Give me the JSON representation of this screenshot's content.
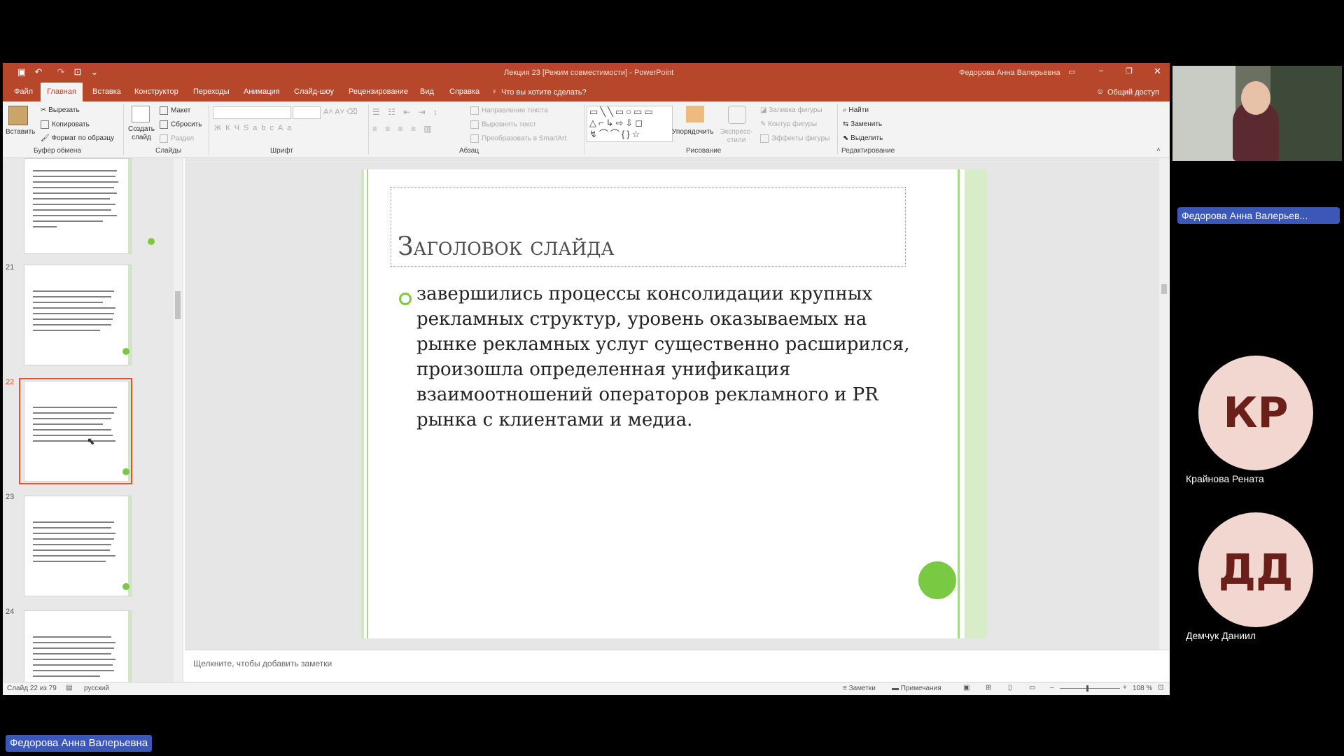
{
  "window": {
    "title": "Лекция 23 [Режим совместимости]  -  PowerPoint",
    "user": "Федорова Анна Валерьевна"
  },
  "tabs": [
    "Файл",
    "Главная",
    "Вставка",
    "Конструктор",
    "Переходы",
    "Анимация",
    "Слайд-шоу",
    "Рецензирование",
    "Вид",
    "Справка"
  ],
  "tell_me": "Что вы хотите сделать?",
  "share": "Общий доступ",
  "ribbon": {
    "clipboard": {
      "paste": "Вставить",
      "cut": "Вырезать",
      "copy": "Копировать",
      "format": "Формат по образцу",
      "label": "Буфер обмена"
    },
    "slides": {
      "new_slide": "Создать слайд",
      "layout": "Макет",
      "reset": "Сбросить",
      "section": "Раздел",
      "label": "Слайды"
    },
    "font": {
      "label": "Шрифт"
    },
    "paragraph": {
      "text_dir": "Направление текста",
      "align_text": "Выровнять текст",
      "smartart": "Преобразовать в SmartArt",
      "label": "Абзац"
    },
    "drawing": {
      "arrange": "Упорядочить",
      "quick_styles": "Экспресс-стили",
      "fill": "Заливка фигуры",
      "outline": "Контур фигуры",
      "effects": "Эффекты фигуры",
      "label": "Рисование"
    },
    "editing": {
      "find": "Найти",
      "replace": "Заменить",
      "select": "Выделить",
      "label": "Редактирование"
    }
  },
  "thumbnails": [
    {
      "num": "",
      "selected": false
    },
    {
      "num": "21",
      "selected": false
    },
    {
      "num": "22",
      "selected": true
    },
    {
      "num": "23",
      "selected": false
    },
    {
      "num": "24",
      "selected": false
    }
  ],
  "slide": {
    "title": "Заголовок слайда",
    "bullet": "завершились процессы консолидации крупных рекламных структур, уровень оказываемых на рынке рекламных услуг существенно расширился, произошла определенная унификация взаимоотношений операторов рекламного и PR рынка с клиентами и медиа."
  },
  "notes_placeholder": "Щелкните, чтобы добавить заметки",
  "status": {
    "slide_info": "Слайд 22 из 79",
    "language": "русский",
    "notes": "Заметки",
    "comments": "Примечания",
    "zoom": "108 %"
  },
  "participants": {
    "speaker_badge": "Федорова Анна Валерьев...",
    "p1_initials": "КР",
    "p1_name": "Крайнова Рената",
    "p2_initials": "ДД",
    "p2_name": "Демчук Даниил",
    "bottom_badge": "Федорова Анна Валерьевна"
  },
  "colors": {
    "accent": "#b7472a",
    "green": "#7ac943",
    "selection": "#e8522c"
  }
}
